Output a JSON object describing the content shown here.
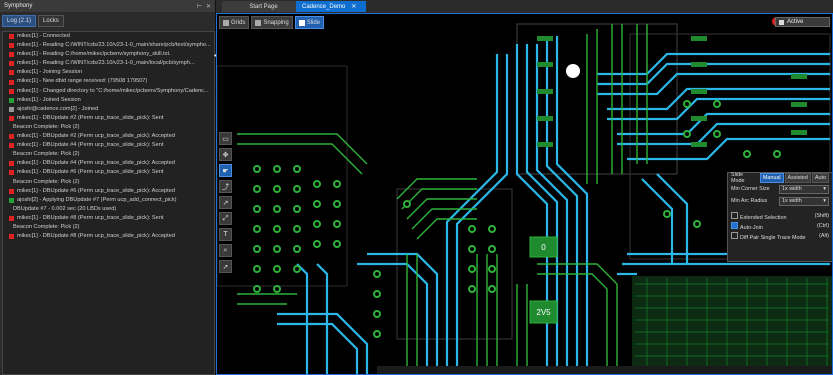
{
  "left_panel": {
    "title": "Symphony",
    "tabs": [
      {
        "label": "Log (2.1)"
      },
      {
        "label": "Locks"
      }
    ],
    "log": [
      {
        "type": "red",
        "text": "mikec[1] - Connected"
      },
      {
        "type": "red",
        "text": "mikec[1] - Reading C:/WINT/cds/23.10/v23-1-0_main/share/pcb/text/sympho..."
      },
      {
        "type": "red",
        "text": "mikec[1] - Reading C:/home/mikec/pcbenv/symphony_skill.txt."
      },
      {
        "type": "red",
        "text": "mikec[1] - Reading C:/WINT/cds/23.10/v23-1-0_main/local/pcb/symph..."
      },
      {
        "type": "red",
        "text": "mikec[1] - Joining Session"
      },
      {
        "type": "red",
        "text": "mikec[1] - New dbid range received: (79508 179507)"
      },
      {
        "type": "red",
        "text": "mikec[1] - Changed directory to \"C:/home/mikec/pcbenv/Symphony/Cadenc..."
      },
      {
        "type": "green",
        "text": "mikec[1] - Joined Session"
      },
      {
        "type": "user",
        "text": "ajoshi@cadence.com[2] - Joined"
      },
      {
        "type": "red",
        "text": "mikec[1] - DBUpdate #2 (Perm ucp_trace_slide_pick): Sent"
      },
      {
        "type": "none",
        "text": "Beacon Complete: Pick (2)"
      },
      {
        "type": "red",
        "text": "mikec[1] - DBUpdate #2 (Perm ucp_trace_slide_pick): Accepted"
      },
      {
        "type": "red",
        "text": "mikec[1] - DBUpdate #4 (Perm ucp_trace_slide_pick): Sent"
      },
      {
        "type": "none",
        "text": "Beacon Complete: Pick (2)"
      },
      {
        "type": "red",
        "text": "mikec[1] - DBUpdate #4 (Perm ucp_trace_slide_pick): Accepted"
      },
      {
        "type": "red",
        "text": "mikec[1] - DBUpdate #6 (Perm ucp_trace_slide_pick): Sent"
      },
      {
        "type": "none",
        "text": "Beacon Complete: Pick (2)"
      },
      {
        "type": "red",
        "text": "mikec[1] - DBUpdate #6 (Perm ucp_trace_slide_pick): Accepted"
      },
      {
        "type": "green",
        "text": "ajoshi[2] - Applying DBUpdate #7 (Perm ucp_add_connect_pick)"
      },
      {
        "type": "none",
        "text": "DBUpdate #7 - 0.002 sec (20 LBDs used)"
      },
      {
        "type": "red",
        "text": "mikec[1] - DBUpdate #8 (Perm ucp_trace_slide_pick): Sent"
      },
      {
        "type": "none",
        "text": "Beacon Complete: Pick (2)"
      },
      {
        "type": "red",
        "text": "mikec[1] - DBUpdate #8 (Perm ucp_trace_slide_pick): Accepted"
      }
    ]
  },
  "doc_tabs": [
    {
      "label": "Start Page"
    },
    {
      "label": "Cadence_Demo"
    }
  ],
  "toolbar": {
    "grids": "Grids",
    "snapping": "Snapping",
    "slide": "Slide",
    "status": "Active"
  },
  "board_labels": {
    "tp0": "0",
    "tp1": "2V5"
  },
  "slide_panel": {
    "mode_label": "Slide Mode",
    "modes": [
      "Manual",
      "Assisted",
      "Auto"
    ],
    "min_corner_label": "Min Corner Size",
    "min_corner_value": "1x width",
    "min_arc_label": "Min Arc Radius",
    "min_arc_value": "1x width",
    "options": [
      {
        "label": "Extended Selection",
        "key": "(Shift)",
        "checked": false
      },
      {
        "label": "Auto-Join",
        "key": "(Ctrl)",
        "checked": true
      },
      {
        "label": "Diff Pair Single Trace Mode",
        "key": "(Alt)",
        "checked": false
      }
    ]
  },
  "colors": {
    "accent": "#1e6fd8",
    "trace_blue": "#2bb7e8",
    "trace_green": "#2db33a",
    "pad_green": "#1f8a2e"
  }
}
